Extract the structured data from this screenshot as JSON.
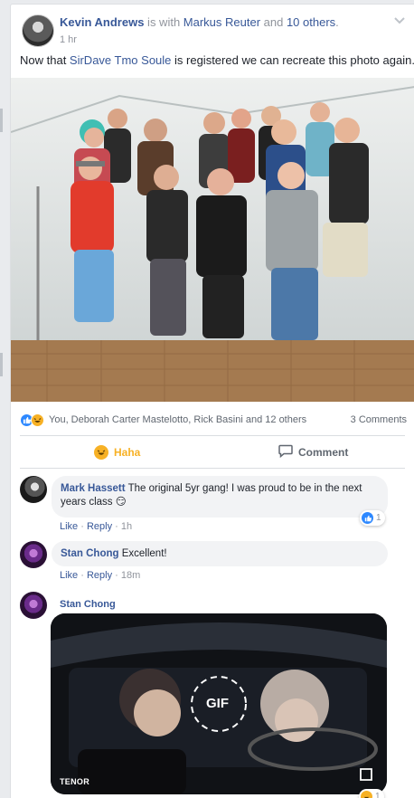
{
  "post": {
    "author": "Kevin Andrews",
    "with_text": " is with ",
    "tagged": "Markus Reuter",
    "and_text": " and ",
    "others": "10 others",
    "period": ".",
    "time": "1 hr",
    "text_before": "Now that ",
    "mention": "SirDave Tmo Soule",
    "text_after": " is registered we can recreate this photo again."
  },
  "reactions": {
    "names": "You, Deborah Carter Mastelotto, Rick Basini and 12 others",
    "comments": "3 Comments",
    "icons": [
      "like-icon",
      "haha-icon"
    ]
  },
  "actions": {
    "haha_label": "Haha",
    "comment_label": "Comment"
  },
  "comments": [
    {
      "name": "Mark Hassett",
      "text": "The original 5yr gang! I was proud to be in the next years class",
      "emoji": "😏",
      "like": "Like",
      "reply": "Reply",
      "time": "1h",
      "reaction_count": "1"
    },
    {
      "name": "Stan Chong",
      "text": "Excellent!",
      "like": "Like",
      "reply": "Reply",
      "time": "18m"
    },
    {
      "name": "Stan Chong",
      "gif_label": "GIF",
      "gif_source": "TENOR",
      "reaction_count": "1"
    }
  ],
  "separator": "·",
  "colors": {
    "link": "#385898",
    "like_blue": "#2d88ff",
    "haha_yellow": "#f7b125",
    "bubble": "#f2f3f5"
  }
}
